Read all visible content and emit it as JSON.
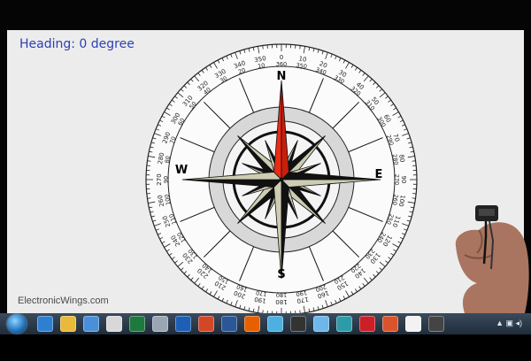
{
  "heading_display": "Heading: 0 degree",
  "watermark": "ElectronicWings.com",
  "compass": {
    "heading_deg": 0,
    "cardinals": {
      "n": "N",
      "e": "E",
      "s": "S",
      "w": "W"
    },
    "needle_color": "#ee2a14",
    "rose_fill": "#cdcdb3"
  },
  "taskbar": {
    "start_icon": "windows-start-orb",
    "apps": [
      "ie-icon",
      "explorer-icon",
      "media-player-icon",
      "chrome-icon",
      "excel-icon",
      "calculator-icon",
      "outlook-icon",
      "powerpoint-icon",
      "word-icon",
      "firefox-icon",
      "paint-icon",
      "processing-icon",
      "notepad-icon",
      "arduino-icon",
      "pinterest-icon",
      "app-icon",
      "app-icon",
      "media-icon"
    ],
    "tray_text": "▲ ▣ ◂)"
  }
}
